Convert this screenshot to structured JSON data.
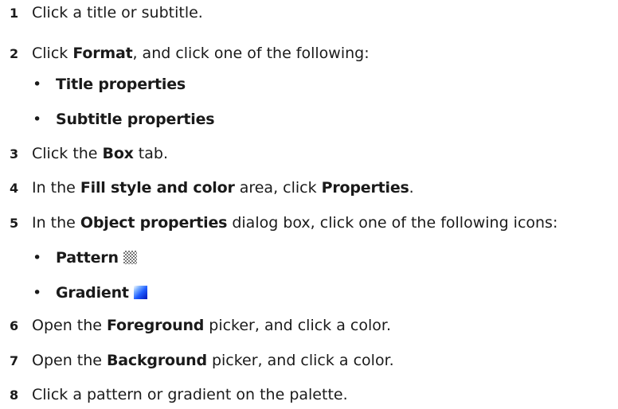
{
  "steps": [
    {
      "number": "1",
      "text": "Click a title or subtitle."
    },
    {
      "number": "2",
      "pre": "Click ",
      "ui": "Format",
      "post": ", and click one of the following:"
    },
    {
      "number": "3",
      "pre": "Click the ",
      "ui": "Box",
      "post": " tab."
    },
    {
      "number": "4",
      "pre": "In the ",
      "ui": "Fill style and color",
      "mid": " area, click ",
      "ui2": "Properties",
      "post": "."
    },
    {
      "number": "5",
      "pre": "In the ",
      "ui": "Object properties",
      "post": " dialog box, click one of the following icons:"
    },
    {
      "number": "6",
      "pre": "Open the ",
      "ui": "Foreground",
      "post": " picker, and click a color."
    },
    {
      "number": "7",
      "pre": "Open the ",
      "ui": "Background",
      "post": " picker, and click a color."
    },
    {
      "number": "8",
      "text": "Click a pattern or gradient on the palette."
    }
  ],
  "step2_options": [
    "Title properties",
    "Subtitle properties"
  ],
  "step5_options": [
    {
      "label": "Pattern",
      "icon": "pattern-icon"
    },
    {
      "label": "Gradient",
      "icon": "gradient-icon"
    }
  ],
  "bullet_char": "•",
  "colors": {
    "text": "#1a1a1a",
    "gradient_dark": "#0014b8",
    "gradient_mid": "#1e5cff"
  }
}
